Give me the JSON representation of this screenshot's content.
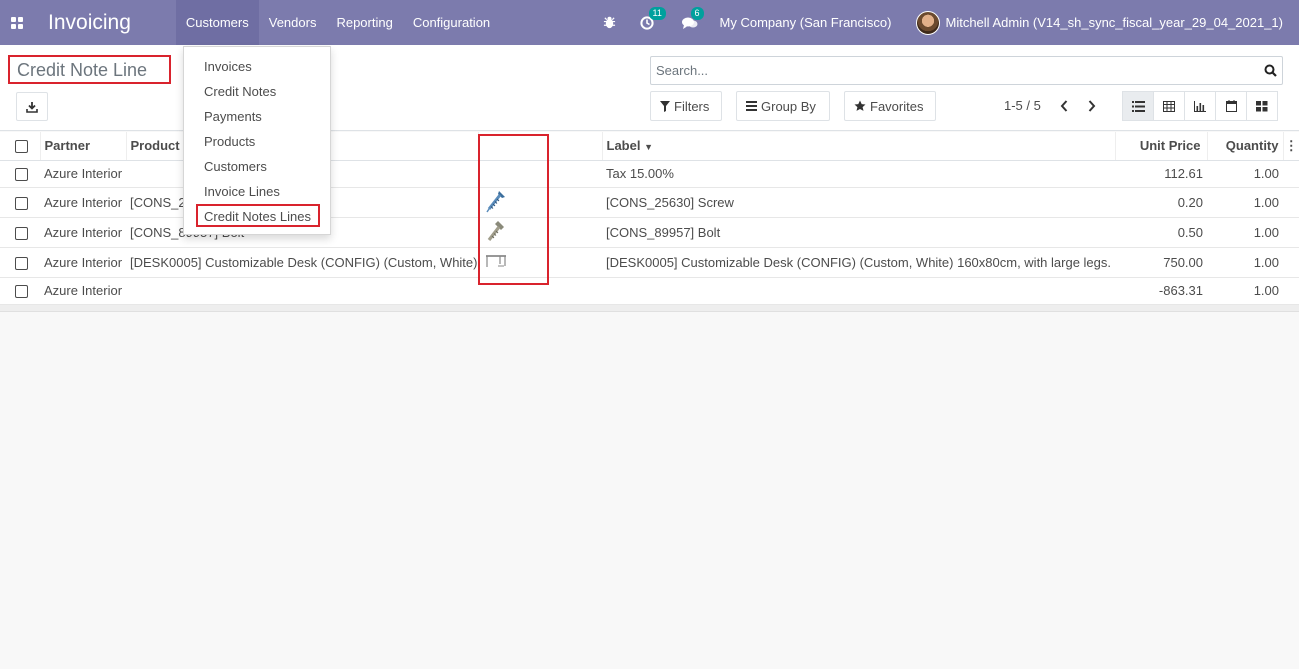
{
  "navbar": {
    "brand": "Invoicing",
    "menus": [
      "Customers",
      "Vendors",
      "Reporting",
      "Configuration"
    ],
    "activity_count": "11",
    "message_count": "6",
    "company": "My Company (San Francisco)",
    "user": "Mitchell Admin (V14_sh_sync_fiscal_year_29_04_2021_1)"
  },
  "page": {
    "title": "Credit Note Line"
  },
  "search": {
    "placeholder": "Search..."
  },
  "filters": {
    "filters_label": "Filters",
    "groupby_label": "Group By",
    "favorites_label": "Favorites"
  },
  "pager": {
    "value": "1-5 / 5"
  },
  "views": [
    "list-view",
    "pivot-view",
    "graph-view",
    "calendar-view",
    "kanban-view"
  ],
  "dropdown": {
    "items": [
      "Invoices",
      "Credit Notes",
      "Payments",
      "Products",
      "Customers",
      "Invoice Lines",
      "Credit Notes Lines"
    ],
    "highlighted": "Credit Notes Lines"
  },
  "table": {
    "headers": {
      "partner": "Partner",
      "product": "Product",
      "label": "Label",
      "unit_price": "Unit Price",
      "quantity": "Quantity"
    },
    "rows": [
      {
        "partner": "Azure Interior",
        "product": "",
        "image": "",
        "label": "Tax 15.00%",
        "unit_price": "112.61",
        "quantity": "1.00"
      },
      {
        "partner": "Azure Interior",
        "product": "[CONS_25630] Screw",
        "image": "screw-icon",
        "label": "[CONS_25630] Screw",
        "unit_price": "0.20",
        "quantity": "1.00"
      },
      {
        "partner": "Azure Interior",
        "product": "[CONS_89957] Bolt",
        "image": "bolt-icon",
        "label": "[CONS_89957] Bolt",
        "unit_price": "0.50",
        "quantity": "1.00"
      },
      {
        "partner": "Azure Interior",
        "product": "[DESK0005] Customizable Desk (CONFIG) (Custom, White)",
        "image": "desk-icon",
        "label": "[DESK0005] Customizable Desk (CONFIG) (Custom, White) 160x80cm, with large legs.",
        "unit_price": "750.00",
        "quantity": "1.00"
      },
      {
        "partner": "Azure Interior",
        "product": "",
        "image": "",
        "label": "",
        "unit_price": "-863.31",
        "quantity": "1.00"
      }
    ]
  },
  "colors": {
    "navbar": "#7c7bad",
    "highlight_box": "#d9232d",
    "badge": "#00a09d"
  }
}
